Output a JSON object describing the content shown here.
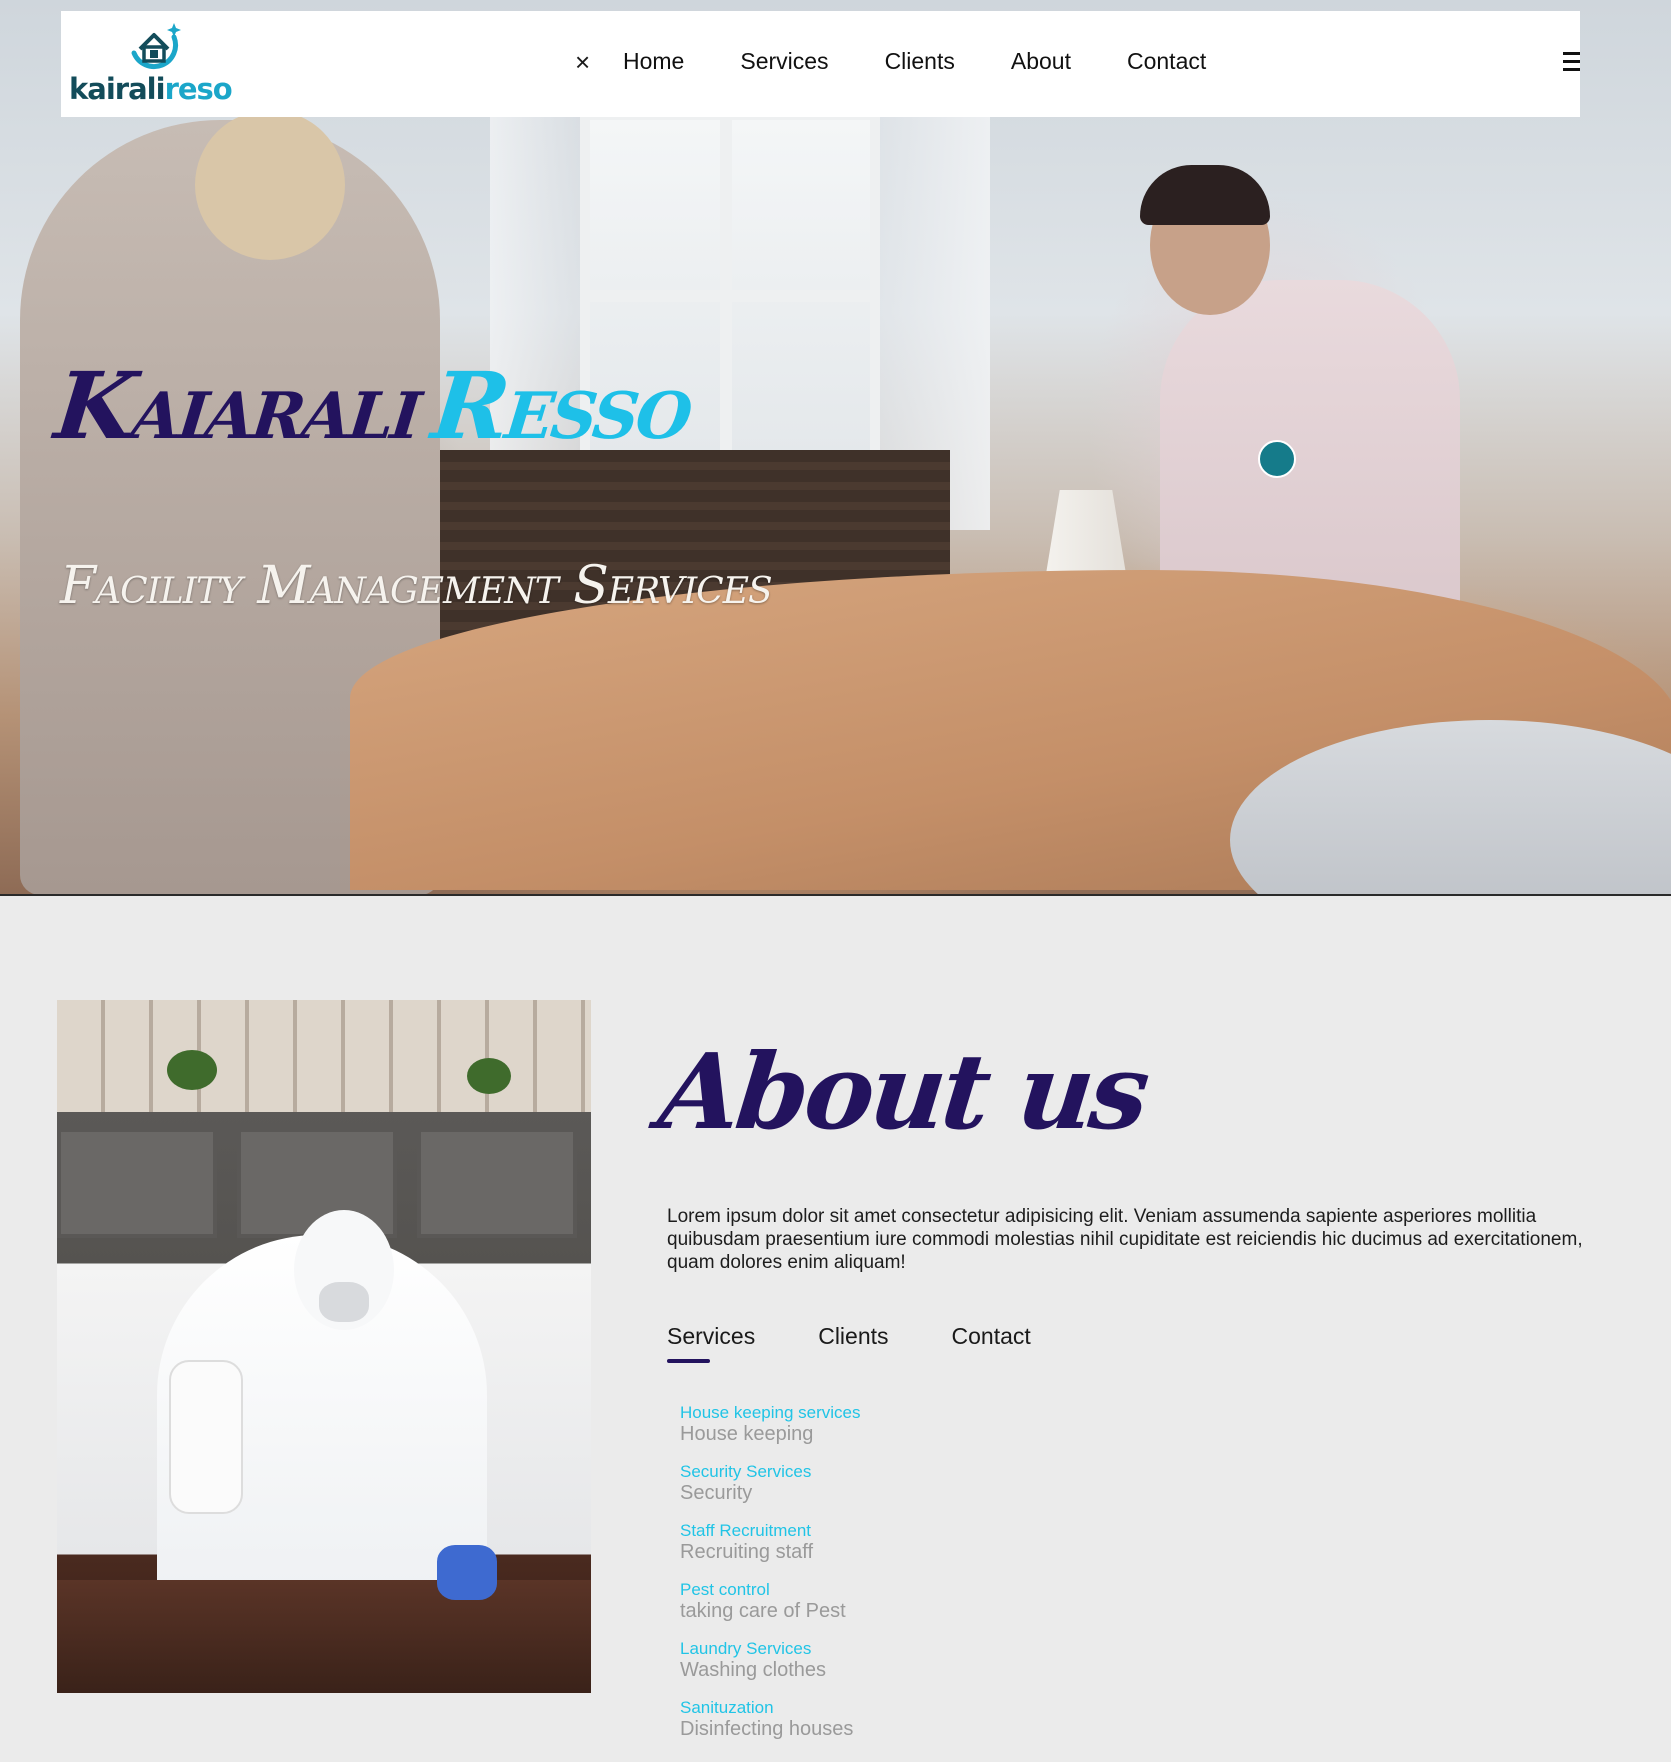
{
  "brand": {
    "logo_text_part1": "kairali",
    "logo_text_part2": "reso"
  },
  "nav": {
    "close_label": "×",
    "links": [
      "Home",
      "Services",
      "Clients",
      "About",
      "Contact"
    ],
    "menu_icon": "hamburger-icon"
  },
  "hero": {
    "title_part1": "Kaiarali",
    "title_part2": "Resso",
    "subtitle": "Facility Management Services"
  },
  "about": {
    "title": "About us",
    "text": "Lorem ipsum dolor sit amet consectetur adipisicing elit. Veniam assumenda sapiente asperiores mollitia quibusdam praesentium iure commodi molestias nihil cupiditate est reiciendis hic ducimus ad exercitationem, quam dolores enim aliquam!",
    "tabs": [
      "Services",
      "Clients",
      "Contact"
    ],
    "active_tab": "Services",
    "services": [
      {
        "name": "House keeping services",
        "desc": "House keeping"
      },
      {
        "name": "Security Services",
        "desc": "Security"
      },
      {
        "name": "Staff Recruitment",
        "desc": "Recruiting staff"
      },
      {
        "name": "Pest control",
        "desc": "taking care of Pest"
      },
      {
        "name": "Laundry Services",
        "desc": "Washing clothes"
      },
      {
        "name": "Sanituzation",
        "desc": "Disinfecting houses"
      }
    ]
  },
  "colors": {
    "brand_dark": "#23135e",
    "brand_cyan": "#1ec0e8",
    "logo_teal": "#134c5a",
    "service_name": "#21c4e6",
    "service_desc": "#9a9a9a",
    "page_bg": "#ebebeb"
  }
}
